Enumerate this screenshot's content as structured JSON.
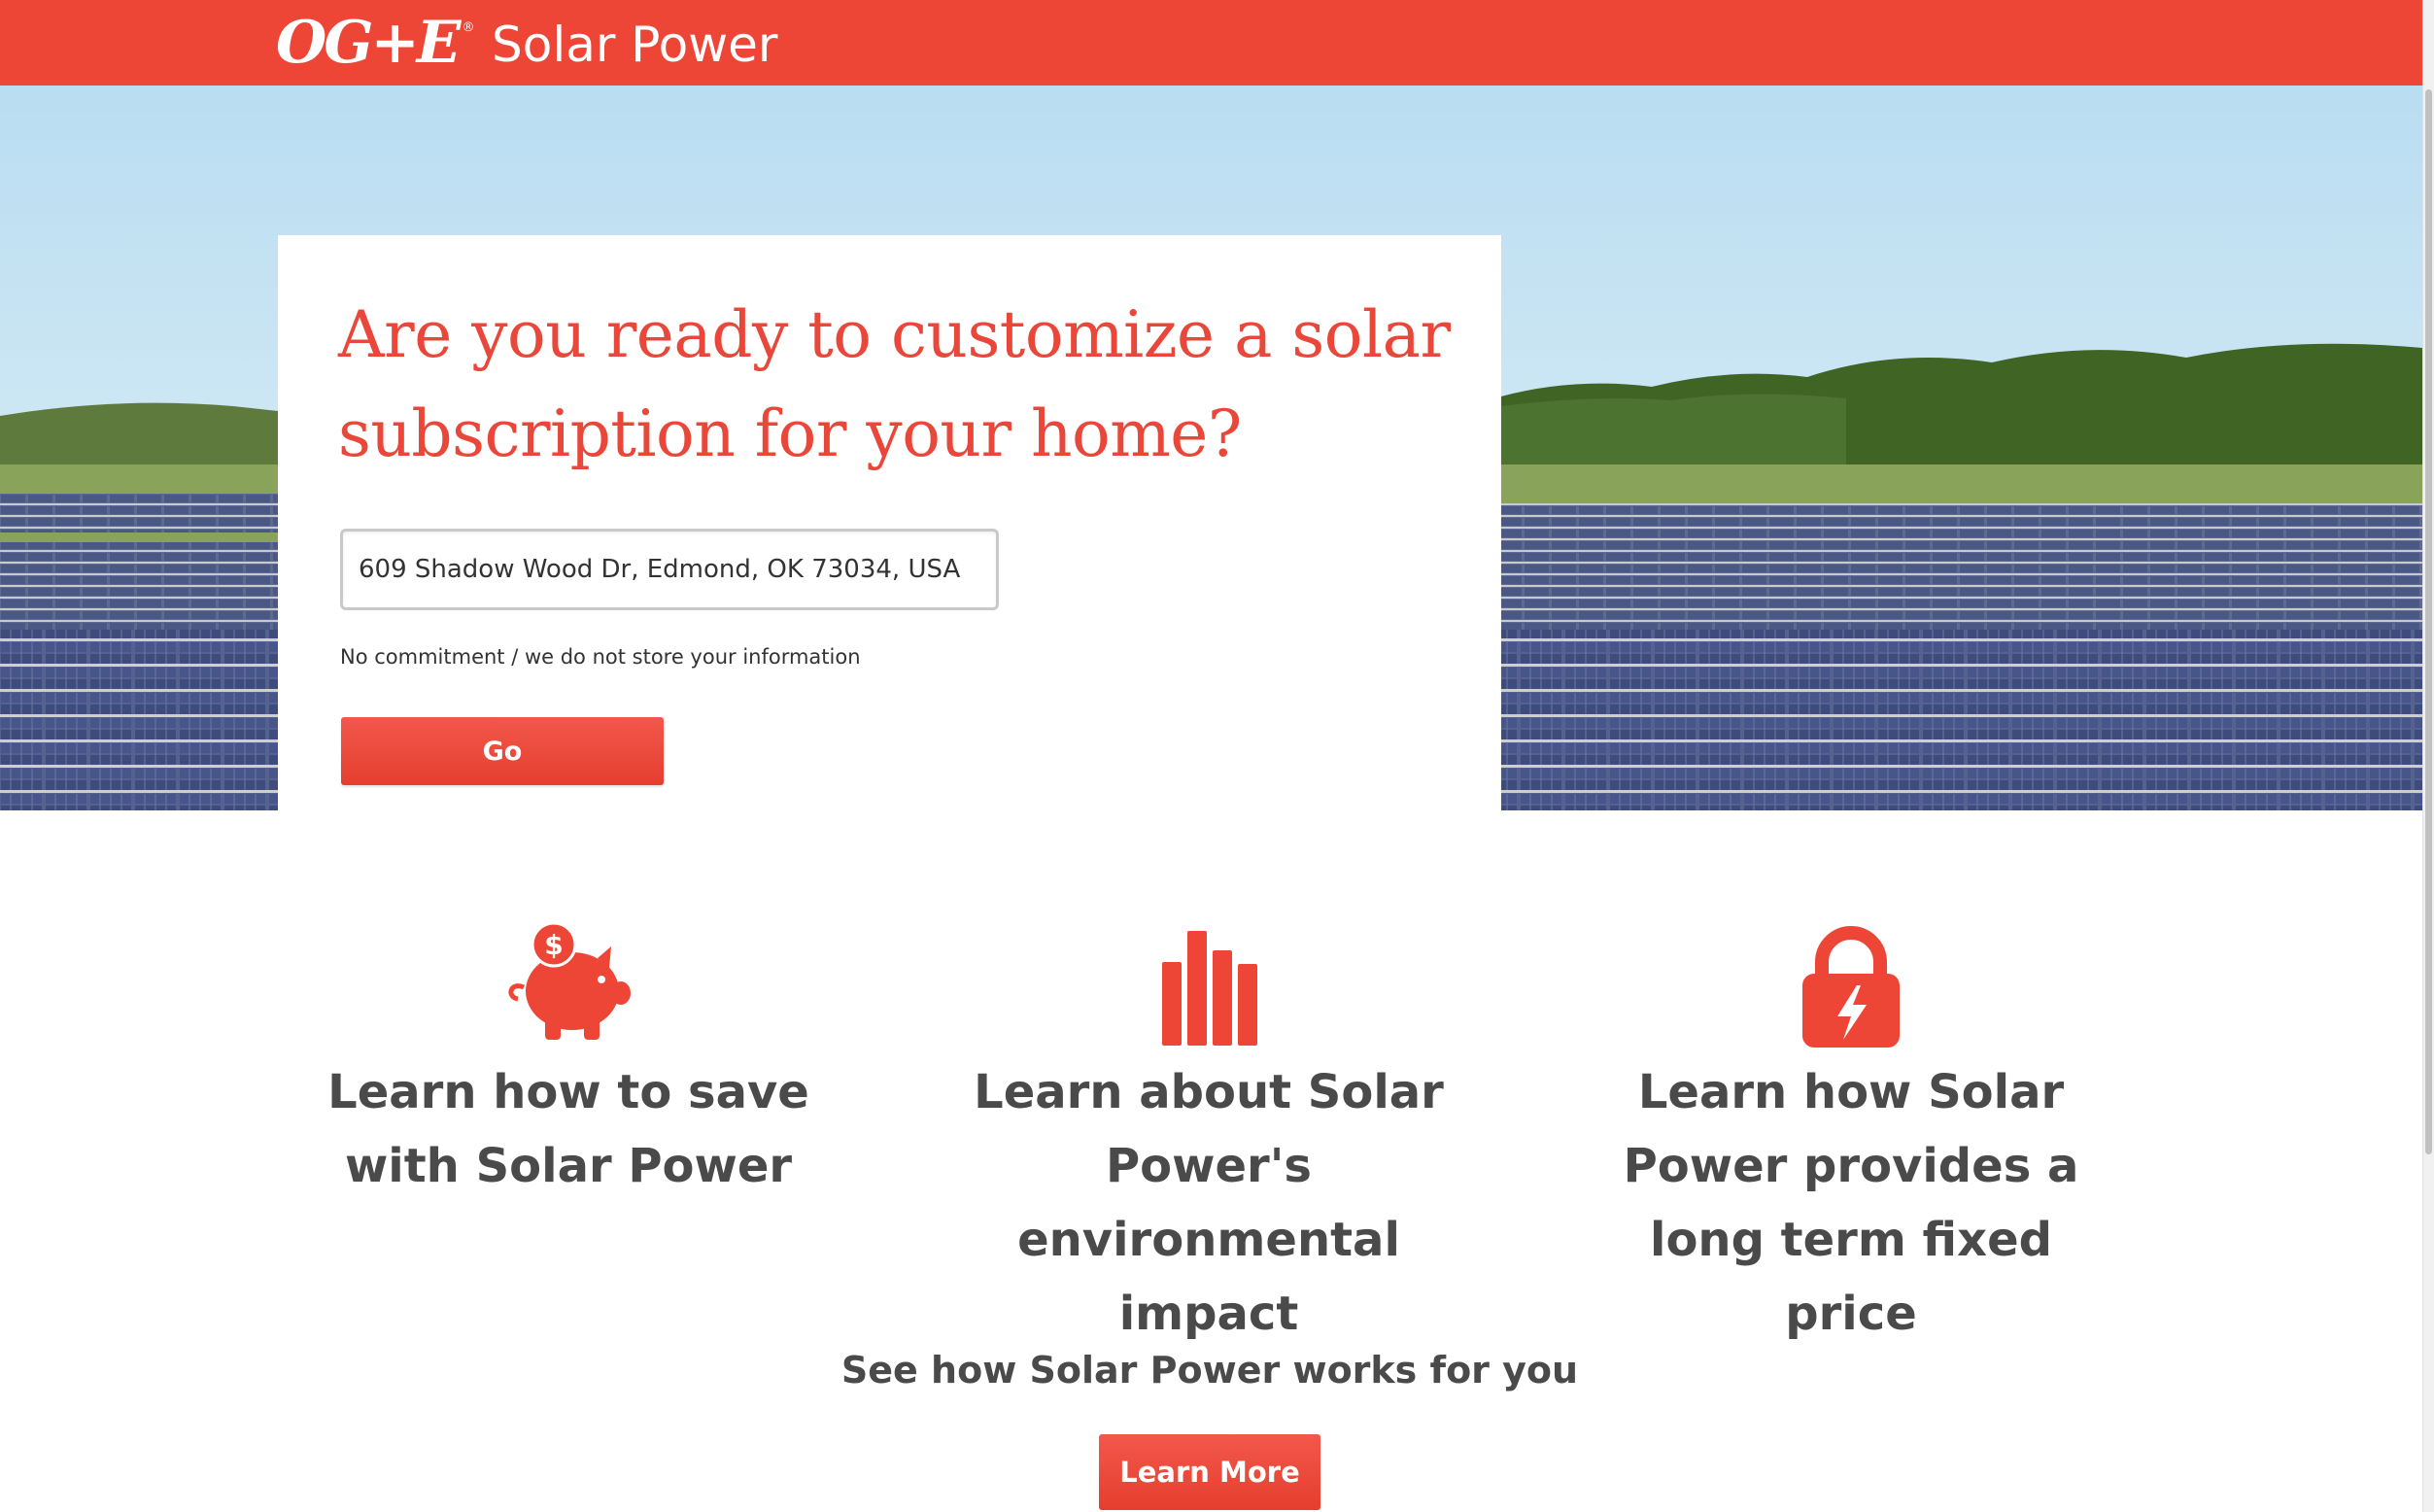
{
  "header": {
    "logo_text": "OG+E",
    "logo_registered": "®",
    "site_title": "Solar Power"
  },
  "hero": {
    "headline": "Are you ready to customize a solar subscription for your home?",
    "address_value": "609 Shadow Wood Dr, Edmond, OK 73034, USA",
    "disclaimer": "No commitment / we do not store your information",
    "go_label": "Go"
  },
  "features": [
    {
      "icon": "piggy-bank-icon",
      "text": "Learn how to save with Solar Power"
    },
    {
      "icon": "bar-chart-icon",
      "text": "Learn about Solar Power's environmental impact"
    },
    {
      "icon": "lock-lightning-icon",
      "text": "Learn how Solar Power provides a long term fixed price"
    }
  ],
  "cta": {
    "text": "See how Solar Power works for you",
    "button_label": "Learn More"
  },
  "colors": {
    "brand_red": "#ee4636",
    "heading_red": "#e8473a",
    "body_text": "#4a4a4a"
  }
}
